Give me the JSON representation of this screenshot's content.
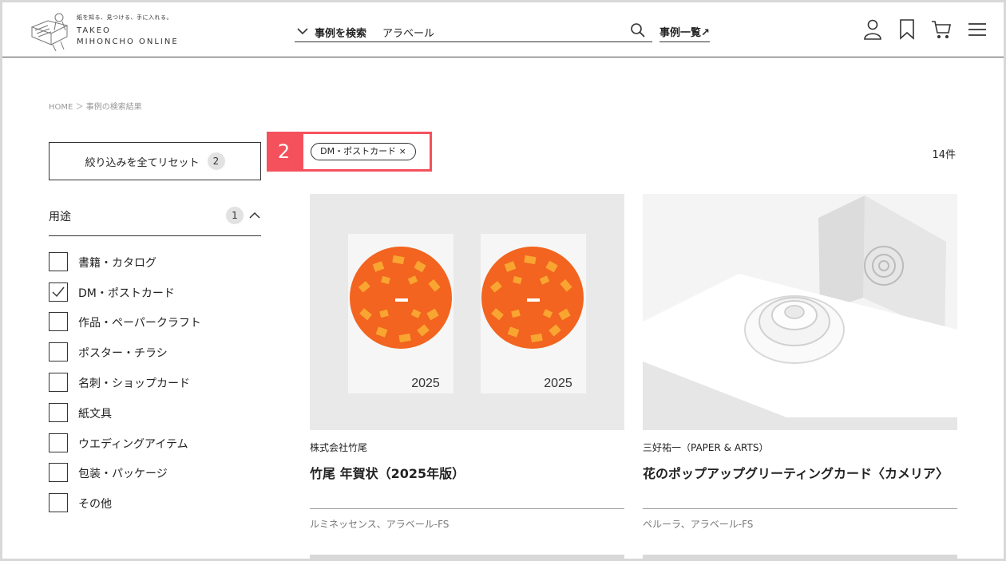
{
  "brand": {
    "tagline": "紙を知る、見つける、手に入れる。",
    "name_line1": "TAKEO",
    "name_line2": "MIHONCHO ONLINE"
  },
  "search": {
    "scope": "事例を検索",
    "query": "アラベール"
  },
  "header": {
    "cases_link": "事例一覧↗",
    "icons": [
      "user-icon",
      "bookmark-icon",
      "cart-icon",
      "menu-icon"
    ]
  },
  "breadcrumb": "HOME ＞ 事例の検索結果",
  "sidebar": {
    "reset_label": "絞り込みを全てリセット",
    "reset_count": "2",
    "filter_title": "用途",
    "filter_count": "1",
    "options": [
      {
        "label": "書籍・カタログ",
        "checked": false
      },
      {
        "label": "DM・ポストカード",
        "checked": true
      },
      {
        "label": "作品・ペーパークラフト",
        "checked": false
      },
      {
        "label": "ポスター・チラシ",
        "checked": false
      },
      {
        "label": "名刺・ショップカード",
        "checked": false
      },
      {
        "label": "紙文具",
        "checked": false
      },
      {
        "label": "ウエディングアイテム",
        "checked": false
      },
      {
        "label": "包装・パッケージ",
        "checked": false
      },
      {
        "label": "その他",
        "checked": false
      }
    ]
  },
  "results": {
    "step_number": "2",
    "active_chip": "DM・ポストカード ×",
    "count": "14件",
    "cards": [
      {
        "company": "株式会社竹尾",
        "title": "竹尾 年賀状（2025年版）",
        "papers": "ルミネッセンス、アラベール-FS",
        "year_text": "2025"
      },
      {
        "company": "三好祐一（PAPER & ARTS）",
        "title": "花のポップアップグリーティングカード〈カメリア〉",
        "papers": "ペルーラ、アラベール-FS"
      }
    ]
  },
  "colors": {
    "accent": "#f4515d",
    "card_orange": "#f2641f",
    "card_orange_light": "#f9a531"
  }
}
